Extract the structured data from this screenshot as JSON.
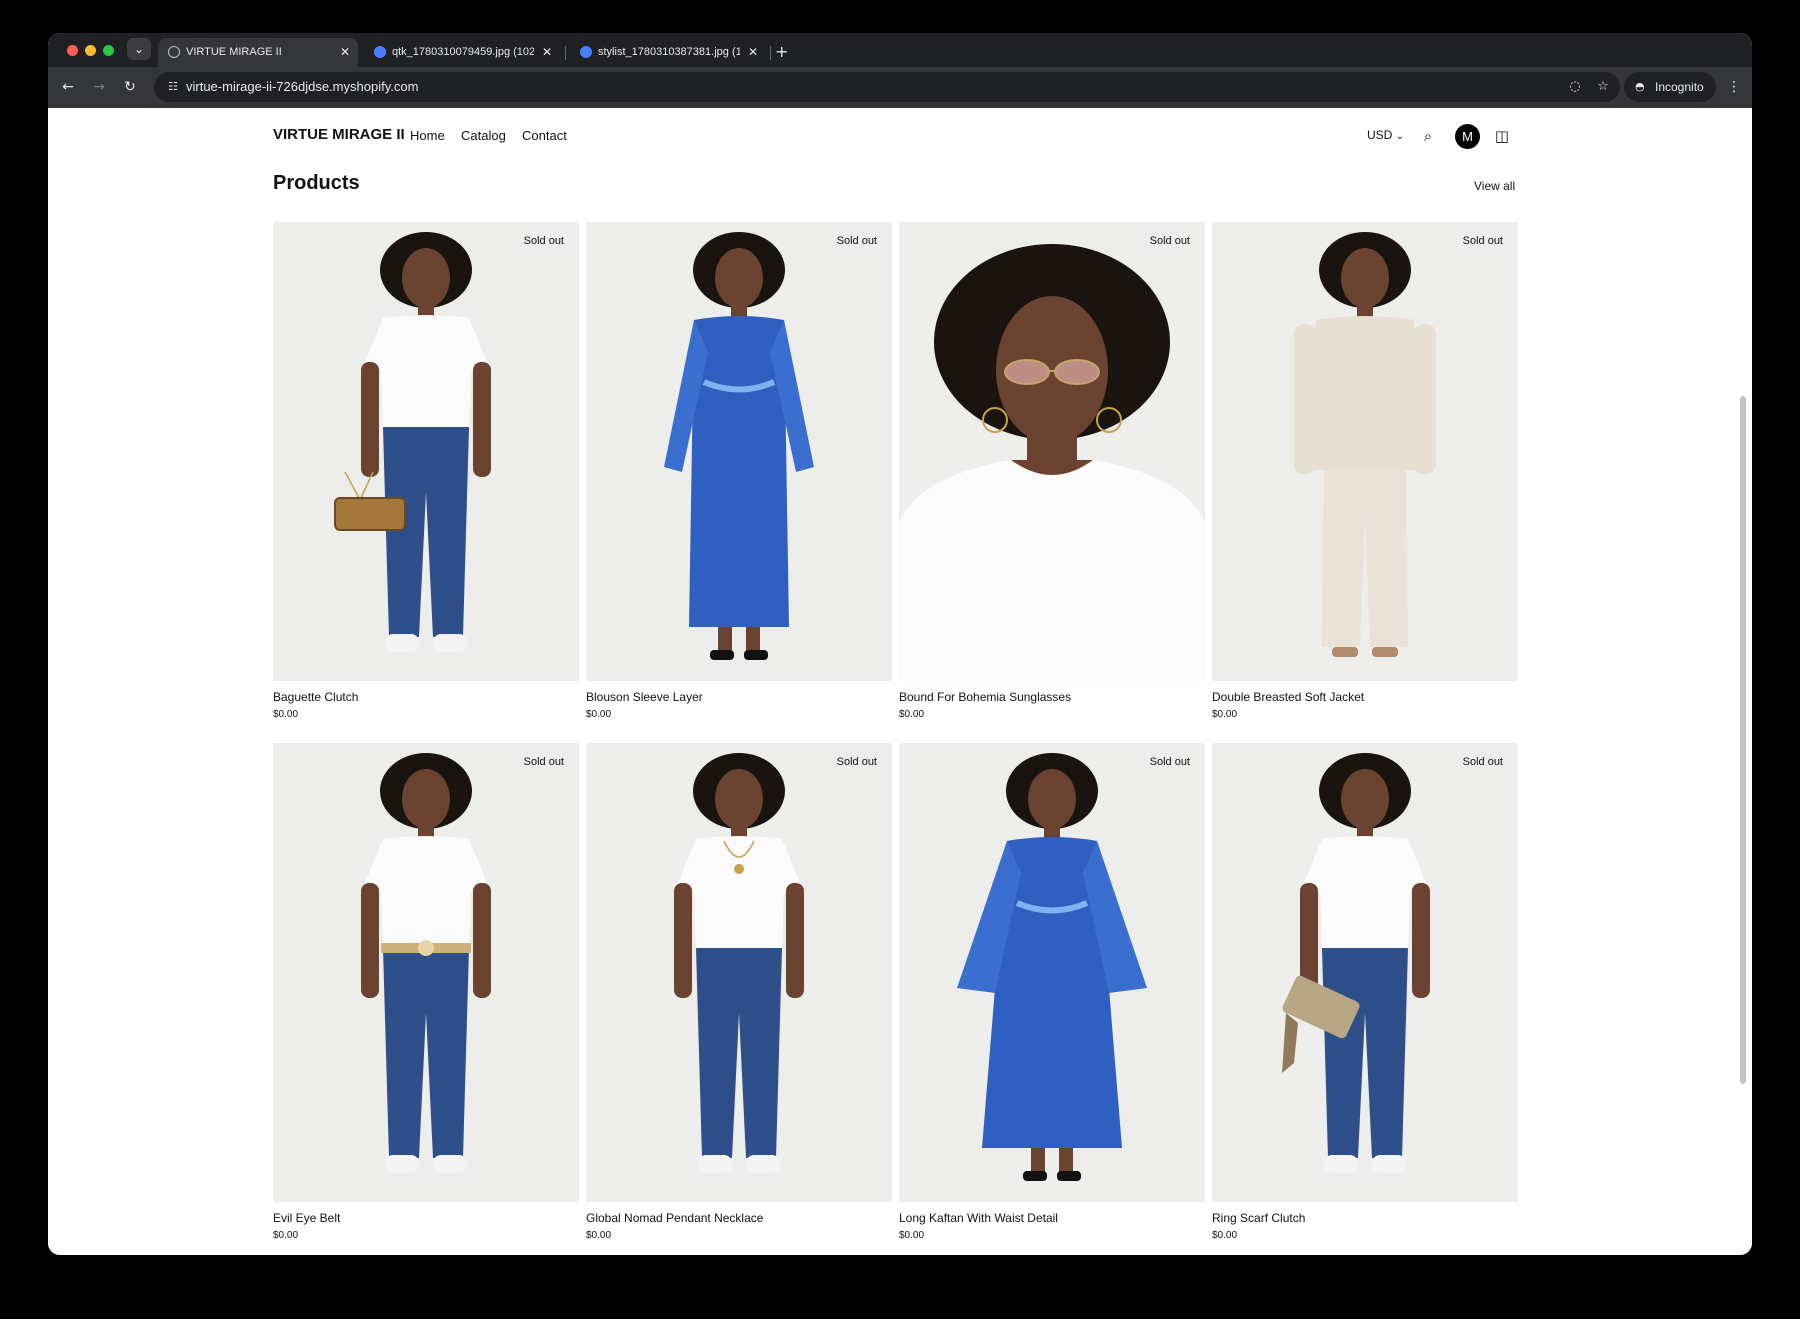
{
  "browser": {
    "tabs": [
      {
        "title": "VIRTUE MIRAGE II",
        "active": true
      },
      {
        "title": "qtk_1780310079459.jpg (102",
        "active": false
      },
      {
        "title": "stylist_1780310387381.jpg (1",
        "active": false
      }
    ],
    "url": "virtue-mirage-ii-726djdse.myshopify.com",
    "incognito_label": "Incognito"
  },
  "header": {
    "logo": "VIRTUE MIRAGE II",
    "nav": [
      "Home",
      "Catalog",
      "Contact"
    ],
    "currency": "USD",
    "avatar_initial": "M"
  },
  "section": {
    "title": "Products",
    "view_all": "View all"
  },
  "products": [
    {
      "name": "Baguette Clutch",
      "price": "$0.00",
      "badge": "Sold out",
      "outfit": "tee-jeans",
      "accessory": "clutch"
    },
    {
      "name": "Blouson Sleeve Layer",
      "price": "$0.00",
      "badge": "Sold out",
      "outfit": "blue-robe",
      "accessory": ""
    },
    {
      "name": "Bound For Bohemia Sunglasses",
      "price": "$0.00",
      "badge": "Sold out",
      "outfit": "portrait",
      "accessory": "sunglasses"
    },
    {
      "name": "Double Breasted Soft Jacket",
      "price": "$0.00",
      "badge": "Sold out",
      "outfit": "cream-suit",
      "accessory": ""
    },
    {
      "name": "Evil Eye Belt",
      "price": "$0.00",
      "badge": "Sold out",
      "outfit": "tee-jeans",
      "accessory": "belt"
    },
    {
      "name": "Global Nomad Pendant Necklace",
      "price": "$0.00",
      "badge": "Sold out",
      "outfit": "tee-jeans",
      "accessory": "necklace"
    },
    {
      "name": "Long Kaftan With Waist Detail",
      "price": "$0.00",
      "badge": "Sold out",
      "outfit": "blue-kaftan",
      "accessory": ""
    },
    {
      "name": "Ring Scarf Clutch",
      "price": "$0.00",
      "badge": "Sold out",
      "outfit": "tee-jeans",
      "accessory": "scarf-clutch"
    }
  ],
  "colors": {
    "browser_frame": "#202124",
    "browser_toolbar": "#35363a",
    "product_background": "#ededeb",
    "text": "#121212",
    "denim": "#2f4f8a",
    "robe_blue": "#2f5fc0",
    "cream": "#e6dfd2",
    "skin": "#6b4331",
    "hair": "#1a1410"
  }
}
